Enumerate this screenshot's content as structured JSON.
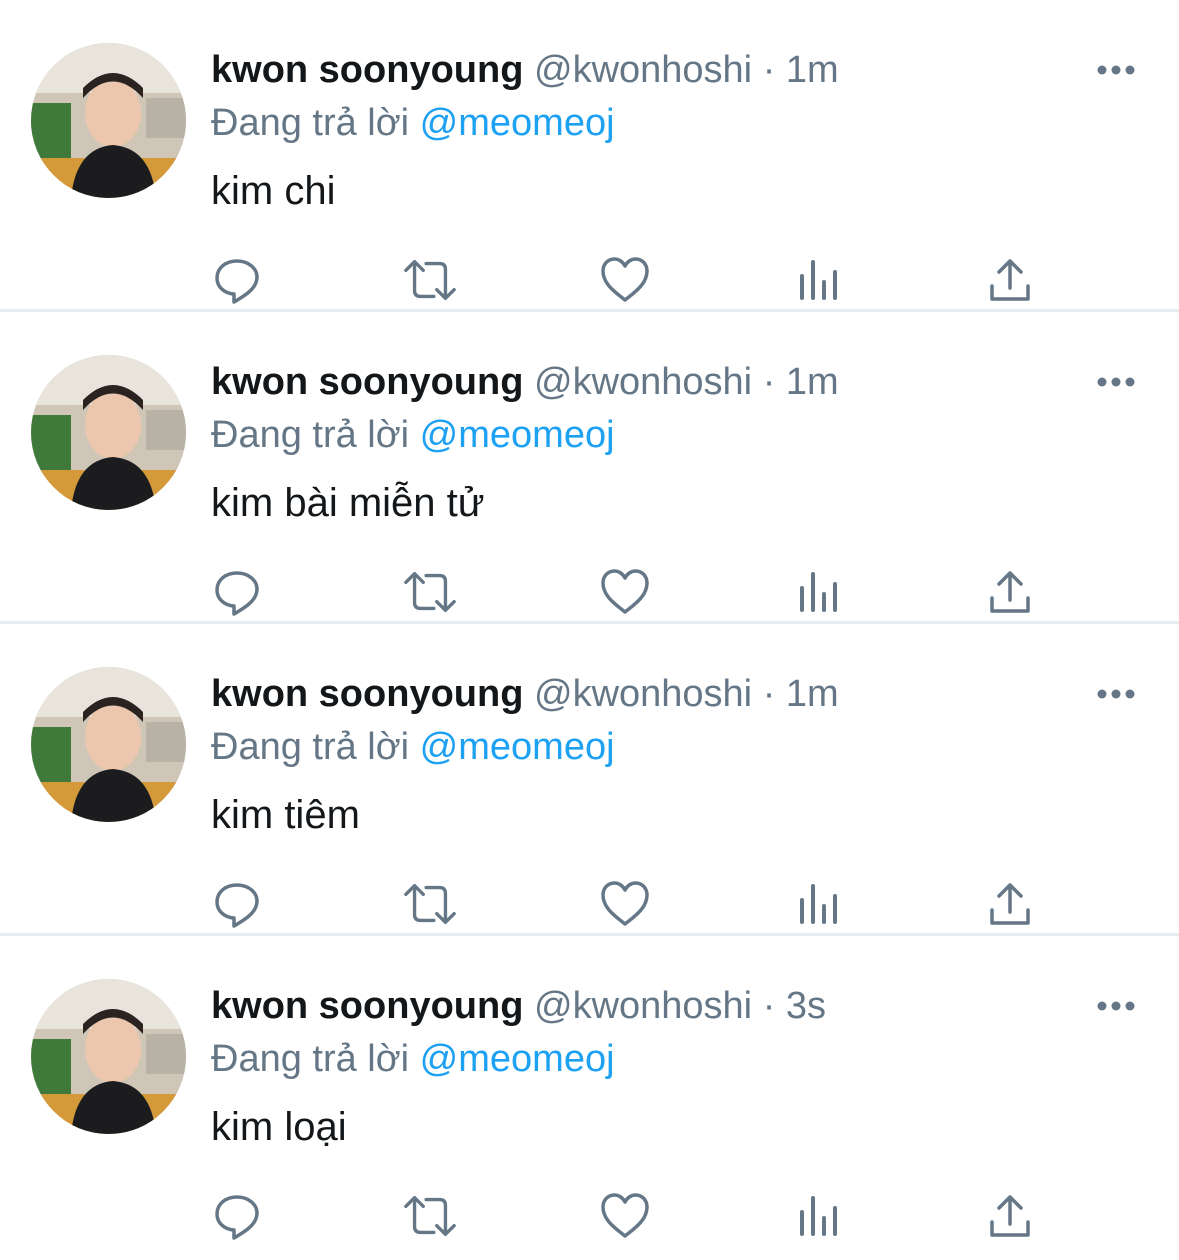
{
  "tweets": [
    {
      "name": "kwon soonyoung",
      "handle": "@kwonhoshi",
      "separator": "·",
      "time": "1m",
      "reply_prefix": "Đang trả lời",
      "reply_to": "@meomeoj",
      "text": "kim chi"
    },
    {
      "name": "kwon soonyoung",
      "handle": "@kwonhoshi",
      "separator": "·",
      "time": "1m",
      "reply_prefix": "Đang trả lời",
      "reply_to": "@meomeoj",
      "text": "kim bài miễn tử"
    },
    {
      "name": "kwon soonyoung",
      "handle": "@kwonhoshi",
      "separator": "·",
      "time": "1m",
      "reply_prefix": "Đang trả lời",
      "reply_to": "@meomeoj",
      "text": "kim tiêm"
    },
    {
      "name": "kwon soonyoung",
      "handle": "@kwonhoshi",
      "separator": "·",
      "time": "3s",
      "reply_prefix": "Đang trả lời",
      "reply_to": "@meomeoj",
      "text": "kim loại"
    }
  ],
  "icons": {
    "more": "more-horizontal-icon",
    "reply": "reply-bubble-icon",
    "retweet": "retweet-icon",
    "like": "heart-icon",
    "analytics": "analytics-bars-icon",
    "share": "share-upload-icon"
  },
  "colors": {
    "text": "#14171a",
    "secondary": "#657786",
    "accent": "#1da1f2",
    "divider": "#e6ecf0"
  }
}
